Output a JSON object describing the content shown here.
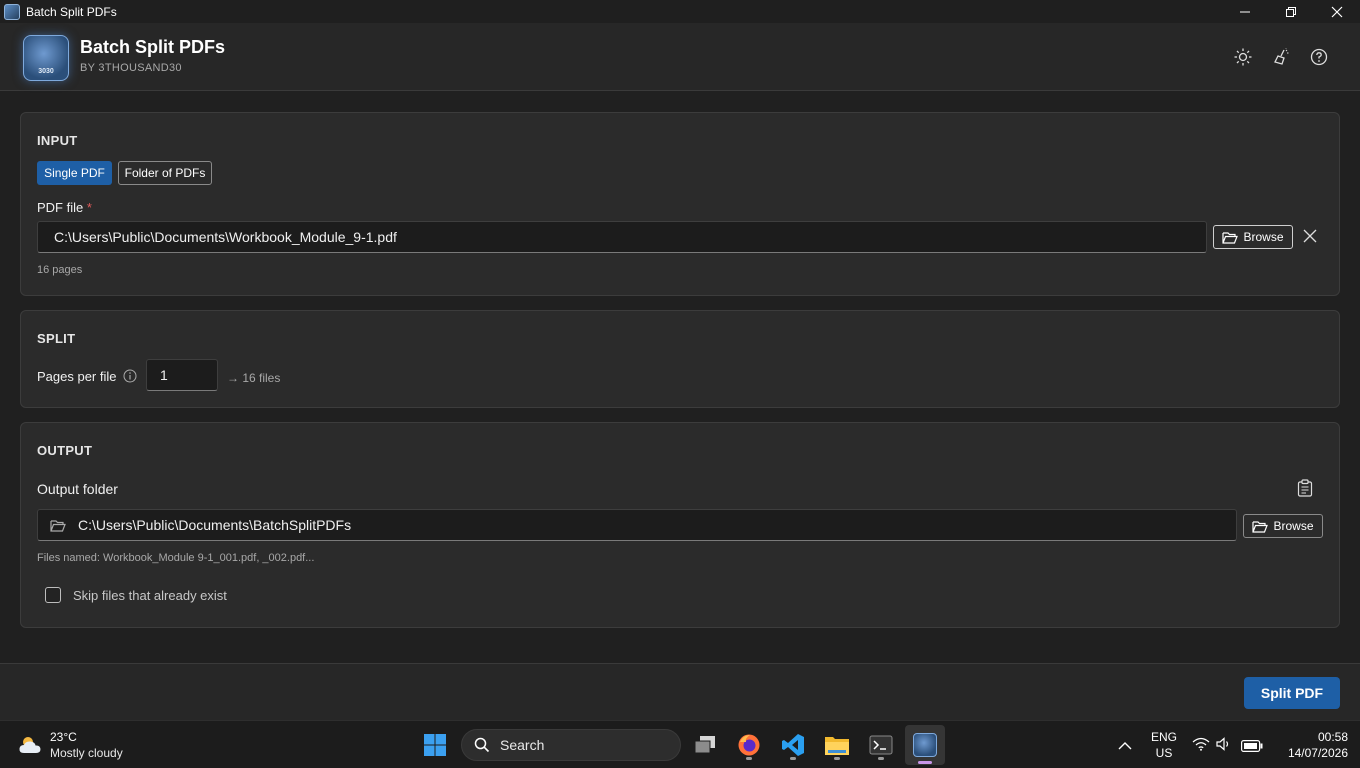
{
  "window": {
    "title": "Batch Split PDFs",
    "controls": [
      "minimize-icon",
      "restore-icon",
      "close-icon"
    ]
  },
  "header": {
    "app_name": "Batch Split PDFs",
    "subtitle": "BY 3THOUSAND30",
    "logo_text": "3030",
    "icons": [
      "theme-sun-icon",
      "broom-icon",
      "help-icon"
    ]
  },
  "input": {
    "section_title": "INPUT",
    "mode_tabs": [
      {
        "label": "Single PDF",
        "selected": true
      },
      {
        "label": "Folder of PDFs",
        "selected": false
      }
    ],
    "pdf_label": "PDF file",
    "required_mark": "*",
    "pdf_path": "C:\\Users\\Public\\Documents\\Workbook_Module_9-1.pdf",
    "browse_label": "Browse",
    "page_count": "16 pages"
  },
  "split": {
    "section_title": "SPLIT",
    "pages_label": "Pages per file",
    "pages_value": "1",
    "result_text": "→ 16 files"
  },
  "output": {
    "section_title": "OUTPUT",
    "folder_label": "Output folder",
    "folder_path": "C:\\Users\\Public\\Documents\\BatchSplitPDFs",
    "browse_label": "Browse",
    "files_named": "Files named: Workbook_Module 9-1_001.pdf, _002.pdf...",
    "skip_label": "Skip files that already exist",
    "skip_checked": false
  },
  "footer": {
    "split_button": "Split PDF"
  },
  "taskbar": {
    "weather_temp": "23°C",
    "weather_desc": "Mostly cloudy",
    "search_label": "Search",
    "apps": [
      "windows-start-icon",
      "task-view-icon",
      "firefox-icon",
      "vscode-icon",
      "file-explorer-icon",
      "terminal-icon",
      "batch-split-pdfs-icon"
    ],
    "lang_primary": "ENG",
    "lang_secondary": "US",
    "time": "00:58",
    "date": "14/07/2026"
  },
  "colors": {
    "accent": "#1e5fa6",
    "background": "#202020",
    "card": "#2b2b2b",
    "required": "#e05a5a"
  }
}
